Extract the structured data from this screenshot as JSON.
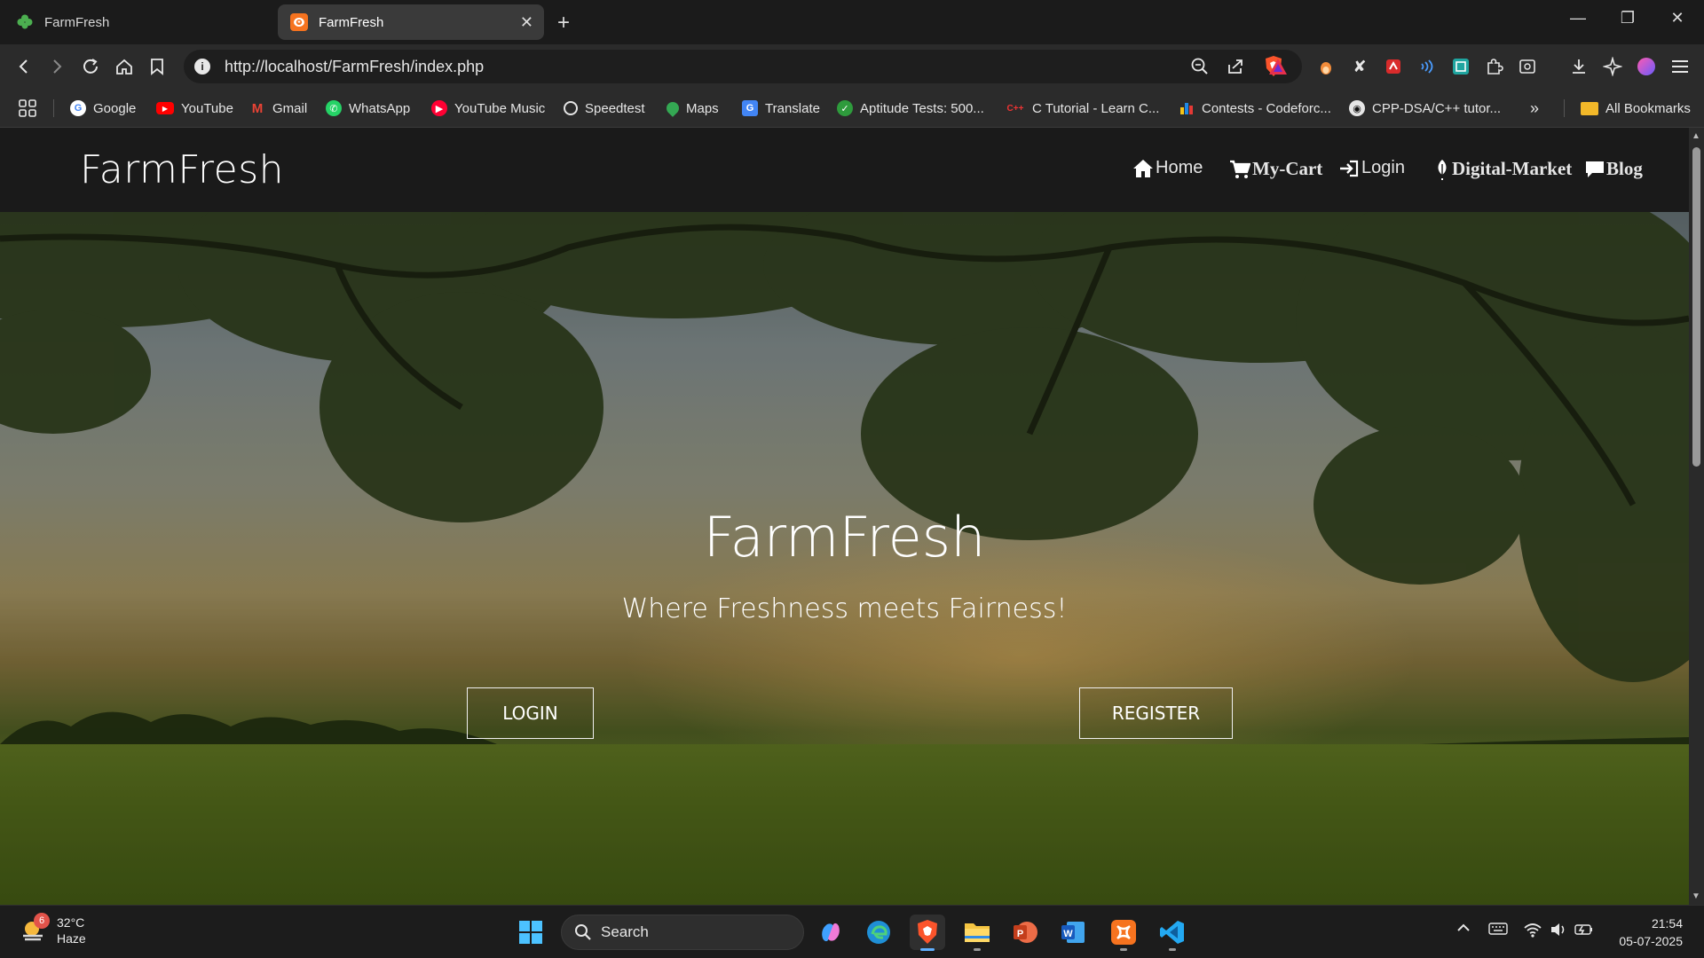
{
  "browser": {
    "tabs": [
      {
        "title": "FarmFresh",
        "active": false
      },
      {
        "title": "FarmFresh",
        "active": true
      }
    ],
    "url": "http://localhost/FarmFresh/index.php",
    "bookmarks": [
      {
        "label": "Google",
        "icon": "google-icon"
      },
      {
        "label": "YouTube",
        "icon": "youtube-icon"
      },
      {
        "label": "Gmail",
        "icon": "gmail-icon"
      },
      {
        "label": "WhatsApp",
        "icon": "whatsapp-icon"
      },
      {
        "label": "YouTube Music",
        "icon": "youtube-music-icon"
      },
      {
        "label": "Speedtest",
        "icon": "speedtest-icon"
      },
      {
        "label": "Maps",
        "icon": "maps-icon"
      },
      {
        "label": "Translate",
        "icon": "translate-icon"
      },
      {
        "label": "Aptitude Tests: 500...",
        "icon": "check-icon"
      },
      {
        "label": "C Tutorial - Learn C...",
        "icon": "cpp-icon"
      },
      {
        "label": "Contests - Codeforc...",
        "icon": "codeforces-icon"
      },
      {
        "label": "CPP-DSA/C++ tutor...",
        "icon": "github-icon"
      }
    ],
    "all_bookmarks_label": "All Bookmarks"
  },
  "site": {
    "brand": "FarmFresh",
    "nav": [
      {
        "label": "Home",
        "icon": "home-icon"
      },
      {
        "label": "My-Cart",
        "icon": "cart-icon"
      },
      {
        "label": "Login",
        "icon": "login-icon"
      },
      {
        "label": "Digital-Market",
        "icon": "leaf-icon"
      },
      {
        "label": "Blog",
        "icon": "comment-icon"
      }
    ],
    "hero": {
      "title": "FarmFresh",
      "subtitle": "Where Freshness meets Fairness!",
      "login_label": "LOGIN",
      "register_label": "REGISTER"
    }
  },
  "taskbar": {
    "weather": {
      "temp": "32°C",
      "condition": "Haze",
      "badge": "6"
    },
    "search_label": "Search",
    "apps": [
      "copilot-icon",
      "edge-icon",
      "brave-icon",
      "file-explorer-icon",
      "powerpoint-icon",
      "word-icon",
      "xampp-icon",
      "vscode-icon"
    ],
    "time": "21:54",
    "date": "05-07-2025"
  },
  "colors": {
    "nav_bg": "#1a1a1a",
    "browser_bg": "#2b2b2b",
    "xampp_orange": "#f6731f"
  }
}
